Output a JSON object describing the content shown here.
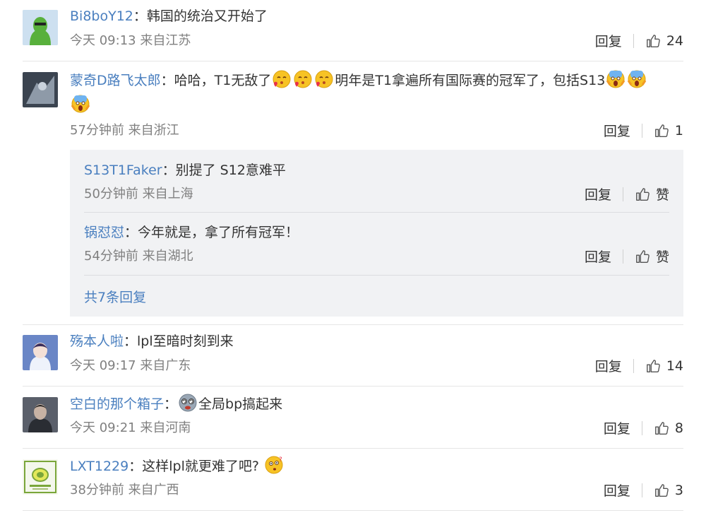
{
  "comments": [
    {
      "user": "Bi8boY12",
      "content": "韩国的统治又开始了",
      "time": "今天 09:13 来自江苏",
      "reply": "回复",
      "likes": "24"
    },
    {
      "user": "蒙奇D路飞太郎",
      "content_a": "哈哈，T1无敌了",
      "content_b": "明年是T1拿遍所有国际赛的冠军了，包括S13",
      "time": "57分钟前 来自浙江",
      "reply": "回复",
      "likes": "1",
      "replies": [
        {
          "user": "S13T1Faker",
          "content": "别提了 S12意难平",
          "time": "50分钟前 来自上海",
          "reply": "回复",
          "likes": "赞"
        },
        {
          "user": "锅怼怼",
          "content": "今年就是，拿了所有冠军！",
          "time": "54分钟前 来自湖北",
          "reply": "回复",
          "likes": "赞"
        }
      ],
      "more_replies": "共7条回复"
    },
    {
      "user": "殇本人啦",
      "content": "lpl至暗时刻到来",
      "time": "今天 09:17 来自广东",
      "reply": "回复",
      "likes": "14"
    },
    {
      "user": "空白的那个箱子",
      "content": "全局bp搞起来",
      "time": "今天 09:21 来自河南",
      "reply": "回复",
      "likes": "8"
    },
    {
      "user": "LXT1229",
      "content": "这样lpl就更难了吧?",
      "time": "38分钟前 来自广西",
      "reply": "回复",
      "likes": "3"
    }
  ],
  "separator": "：",
  "icons": {
    "like": "thumbs-up-icon",
    "emoji_kiss": "kiss-emoji-icon",
    "emoji_scream": "scream-emoji-icon",
    "emoji_think": "thinking-emoji-icon",
    "emoji_dizzy": "dizzy-emoji-icon"
  }
}
